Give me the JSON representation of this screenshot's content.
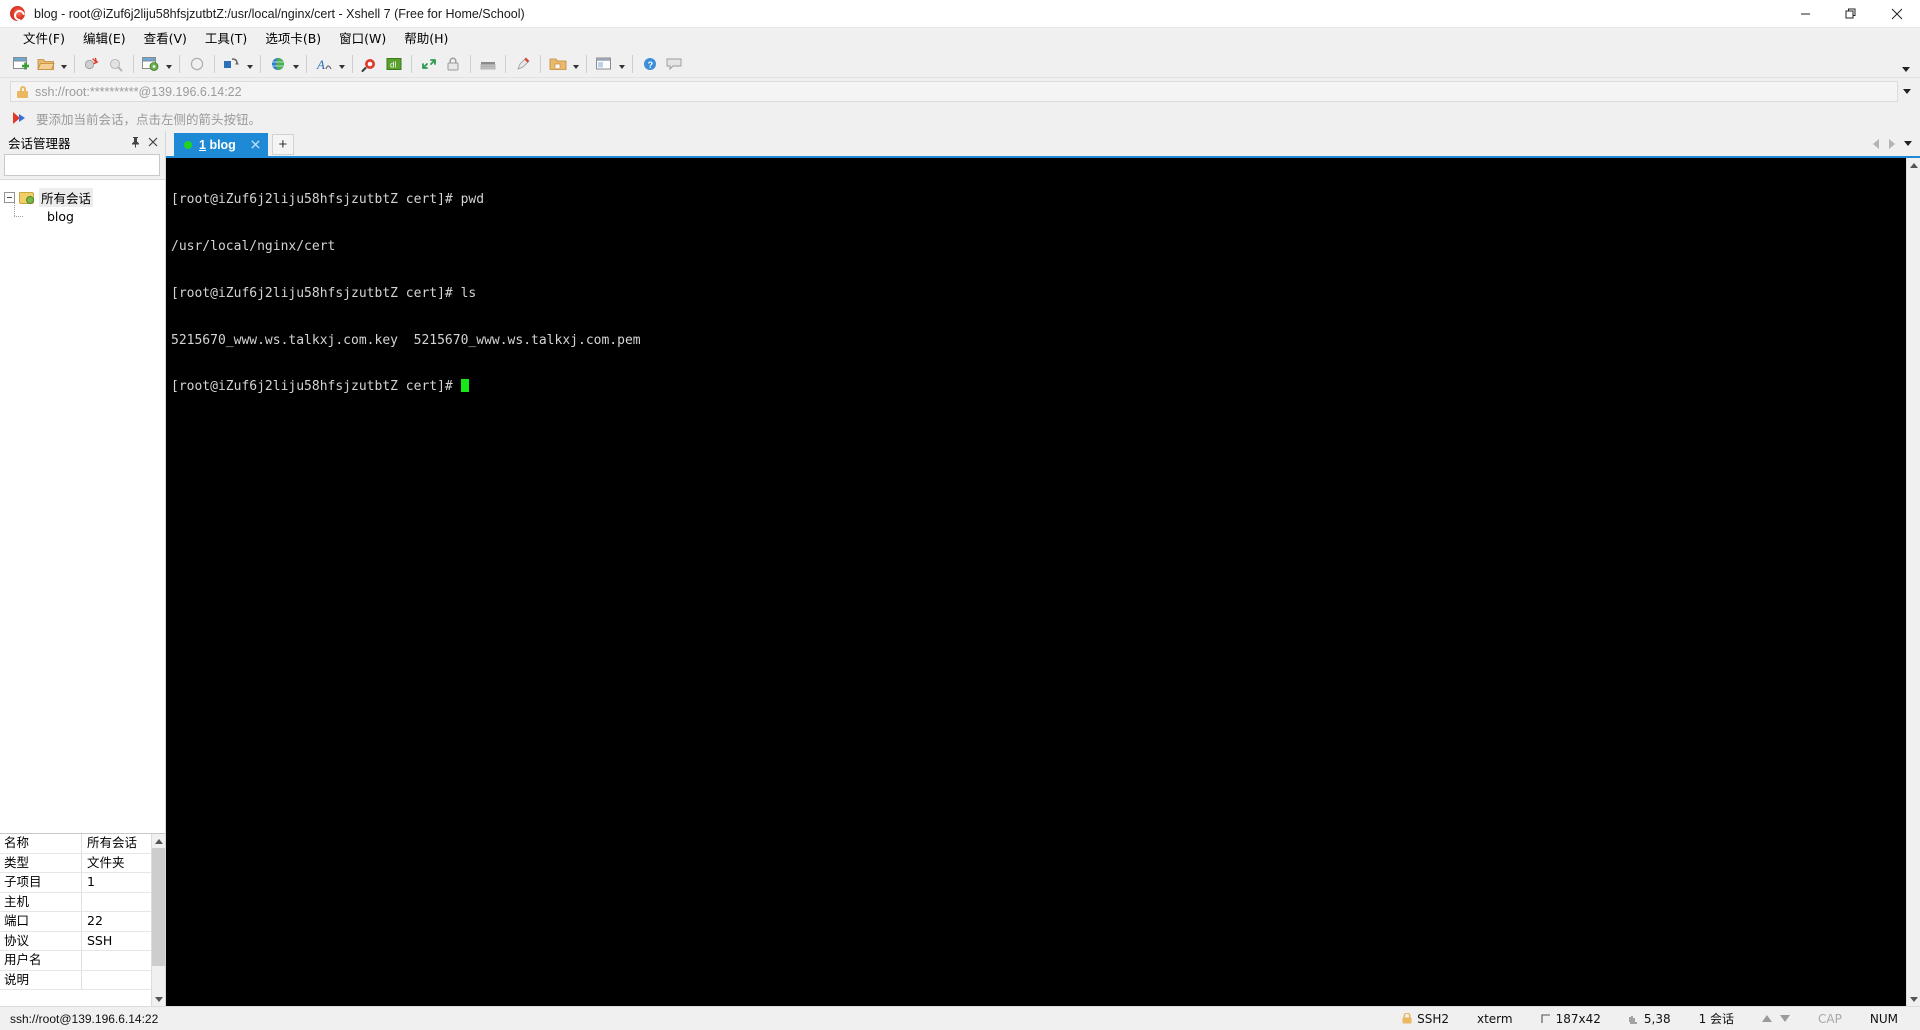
{
  "window": {
    "title": "blog - root@iZuf6j2liju58hfsjzutbtZ:/usr/local/nginx/cert - Xshell 7 (Free for Home/School)",
    "app_icon": "xshell-logo-icon",
    "minimize_label": "—",
    "restore_label": "❐",
    "close_label": "✕"
  },
  "menu": {
    "items": [
      {
        "label": "文件(F)",
        "name": "menu-file"
      },
      {
        "label": "编辑(E)",
        "name": "menu-edit"
      },
      {
        "label": "查看(V)",
        "name": "menu-view"
      },
      {
        "label": "工具(T)",
        "name": "menu-tools"
      },
      {
        "label": "选项卡(B)",
        "name": "menu-tabs"
      },
      {
        "label": "窗口(W)",
        "name": "menu-window"
      },
      {
        "label": "帮助(H)",
        "name": "menu-help"
      }
    ]
  },
  "toolbar": {
    "overflow_label": "▼",
    "icons": [
      "new-session-icon",
      "open-session-icon",
      "open-session-dropdown",
      "disconnect-icon",
      "reconnect-icon",
      "session-properties-icon",
      "session-properties-dropdown",
      "clear-screen-icon",
      "transfer-icon",
      "transfer-dropdown",
      "web-browser-icon",
      "web-browser-dropdown",
      "font-icon",
      "font-dropdown",
      "find-icon",
      "log-icon",
      "fullscreen-icon",
      "lock-icon",
      "keyboard-icon",
      "highlight-icon",
      "folder-color-icon",
      "folder-color-dropdown",
      "layout-icon",
      "layout-dropdown",
      "help-icon",
      "comment-icon"
    ]
  },
  "address_bar": {
    "value": "ssh://root:**********@139.196.6.14:22",
    "placeholder": "ssh://root:**********@139.196.6.14:22",
    "lock_icon": "lock-icon",
    "dropdown_icon": "chevron-down-icon"
  },
  "tip_bar": {
    "icon": "red-arrow-icon",
    "text": "要添加当前会话，点击左侧的箭头按钮。"
  },
  "session_manager": {
    "title": "会话管理器",
    "pin_icon": "pin-icon",
    "close_icon": "close-icon",
    "search": {
      "value": "",
      "placeholder": "",
      "icon": "search-icon"
    },
    "tree": [
      {
        "label": "所有会话",
        "level": 0,
        "icon": "folder-icon",
        "selected": true
      },
      {
        "label": "blog",
        "level": 1,
        "icon": "session-icon",
        "selected": false
      }
    ]
  },
  "properties": {
    "rows": [
      {
        "key": "名称",
        "value": "所有会话"
      },
      {
        "key": "类型",
        "value": "文件夹"
      },
      {
        "key": "子项目",
        "value": "1"
      },
      {
        "key": "主机",
        "value": ""
      },
      {
        "key": "端口",
        "value": "22"
      },
      {
        "key": "协议",
        "value": "SSH"
      },
      {
        "key": "用户名",
        "value": ""
      },
      {
        "key": "说明",
        "value": ""
      }
    ],
    "scroll_up_icon": "chevron-up-icon",
    "scroll_down_icon": "chevron-down-icon"
  },
  "tabs": {
    "items": [
      {
        "index": "1",
        "label": "blog",
        "status_dot": "connected",
        "close_icon": "close-icon"
      }
    ],
    "new_tab_label": "+",
    "nav_prev_icon": "chevron-left-icon",
    "nav_next_icon": "chevron-right-icon",
    "nav_menu_icon": "chevron-down-icon"
  },
  "terminal": {
    "lines": [
      "[root@iZuf6j2liju58hfsjzutbtZ cert]# pwd",
      "/usr/local/nginx/cert",
      "[root@iZuf6j2liju58hfsjzutbtZ cert]# ls",
      "5215670_www.ws.talkxj.com.key  5215670_www.ws.talkxj.com.pem"
    ],
    "prompt": "[root@iZuf6j2liju58hfsjzutbtZ cert]# ",
    "cursor_color": "#17e817",
    "background": "#000000",
    "foreground": "#d4d4d4"
  },
  "status_bar": {
    "connection": "ssh://root@139.196.6.14:22",
    "protocol": "SSH2",
    "protocol_icon": "lock-icon",
    "terminal_type": "xterm",
    "size": "187x42",
    "size_icon": "screen-size-icon",
    "cursor_pos": "5,38",
    "cursor_icon": "cursor-pos-icon",
    "sessions": "1 会话",
    "scroll_up_icon": "arrow-up-icon",
    "scroll_down_icon": "arrow-down-icon",
    "caps": "CAP",
    "num": "NUM"
  }
}
